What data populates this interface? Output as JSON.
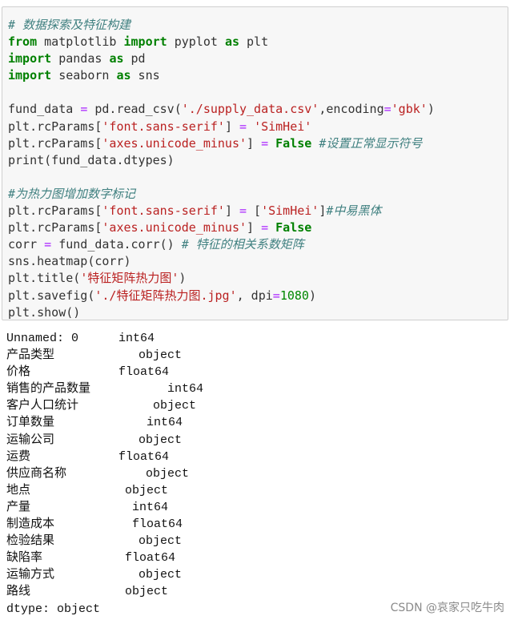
{
  "code_cell": {
    "lines": [
      [
        [
          "cm",
          "# 数据探索及特征构建"
        ]
      ],
      [
        [
          "kw",
          "from"
        ],
        [
          "t",
          " matplotlib "
        ],
        [
          "kw",
          "import"
        ],
        [
          "t",
          " pyplot "
        ],
        [
          "kw",
          "as"
        ],
        [
          "t",
          " plt"
        ]
      ],
      [
        [
          "kw",
          "import"
        ],
        [
          "t",
          " pandas "
        ],
        [
          "kw",
          "as"
        ],
        [
          "t",
          " pd"
        ]
      ],
      [
        [
          "kw",
          "import"
        ],
        [
          "t",
          " seaborn "
        ],
        [
          "kw",
          "as"
        ],
        [
          "t",
          " sns"
        ]
      ],
      [],
      [
        [
          "t",
          "fund_data "
        ],
        [
          "op",
          "="
        ],
        [
          "t",
          " pd.read_csv("
        ],
        [
          "str",
          "'./supply_data.csv'"
        ],
        [
          "t",
          ",encoding"
        ],
        [
          "op",
          "="
        ],
        [
          "str",
          "'gbk'"
        ],
        [
          "t",
          ")"
        ]
      ],
      [
        [
          "t",
          "plt.rcParams["
        ],
        [
          "str",
          "'font.sans-serif'"
        ],
        [
          "t",
          "] "
        ],
        [
          "op",
          "="
        ],
        [
          "t",
          " "
        ],
        [
          "str",
          "'SimHei'"
        ]
      ],
      [
        [
          "t",
          "plt.rcParams["
        ],
        [
          "str",
          "'axes.unicode_minus'"
        ],
        [
          "t",
          "] "
        ],
        [
          "op",
          "="
        ],
        [
          "t",
          " "
        ],
        [
          "kw",
          "False"
        ],
        [
          "t",
          " "
        ],
        [
          "cm",
          "#设置正常显示符号"
        ]
      ],
      [
        [
          "t",
          "print(fund_data.dtypes)"
        ]
      ],
      [],
      [
        [
          "cm",
          "#为热力图增加数字标记"
        ]
      ],
      [
        [
          "t",
          "plt.rcParams["
        ],
        [
          "str",
          "'font.sans-serif'"
        ],
        [
          "t",
          "] "
        ],
        [
          "op",
          "="
        ],
        [
          "t",
          " ["
        ],
        [
          "str",
          "'SimHei'"
        ],
        [
          "t",
          "]"
        ],
        [
          "cm",
          "#中易黑体"
        ]
      ],
      [
        [
          "t",
          "plt.rcParams["
        ],
        [
          "str",
          "'axes.unicode_minus'"
        ],
        [
          "t",
          "] "
        ],
        [
          "op",
          "="
        ],
        [
          "t",
          " "
        ],
        [
          "kw",
          "False"
        ]
      ],
      [
        [
          "t",
          "corr "
        ],
        [
          "op",
          "="
        ],
        [
          "t",
          " fund_data.corr() "
        ],
        [
          "cm",
          "# 特征的相关系数矩阵"
        ]
      ],
      [
        [
          "t",
          "sns.heatmap(corr)"
        ]
      ],
      [
        [
          "t",
          "plt.title("
        ],
        [
          "str",
          "'特征矩阵热力图'"
        ],
        [
          "t",
          ")"
        ]
      ],
      [
        [
          "t",
          "plt.savefig("
        ],
        [
          "str",
          "'./特征矩阵热力图.jpg'"
        ],
        [
          "t",
          ", dpi"
        ],
        [
          "op",
          "="
        ],
        [
          "num",
          "1080"
        ],
        [
          "t",
          ")"
        ]
      ],
      [
        [
          "t",
          "plt.show()"
        ]
      ]
    ]
  },
  "output": {
    "rows": [
      {
        "name": "Unnamed: 0",
        "dtype": "int64"
      },
      {
        "name": "产品类型",
        "dtype": "object"
      },
      {
        "name": "价格",
        "dtype": "float64"
      },
      {
        "name": "销售的产品数量",
        "dtype": "int64"
      },
      {
        "name": "客户人口统计",
        "dtype": "object"
      },
      {
        "name": "订单数量",
        "dtype": "int64"
      },
      {
        "name": "运输公司",
        "dtype": "object"
      },
      {
        "name": "运费",
        "dtype": "float64"
      },
      {
        "name": "供应商名称",
        "dtype": "object"
      },
      {
        "name": "地点",
        "dtype": "object"
      },
      {
        "name": "产量",
        "dtype": "int64"
      },
      {
        "name": "制造成本",
        "dtype": "float64"
      },
      {
        "name": "检验结果",
        "dtype": "object"
      },
      {
        "name": "缺陷率",
        "dtype": "float64"
      },
      {
        "name": "运输方式",
        "dtype": "object"
      },
      {
        "name": "路线",
        "dtype": "object"
      }
    ],
    "footer": "dtype: object"
  },
  "watermark": "CSDN @哀家只吃牛肉",
  "colors": {
    "keyword": "#008000",
    "string": "#ba2121",
    "comment": "#408080",
    "operator": "#aa22ff",
    "number": "#008800",
    "cell_bg": "#f7f7f7"
  }
}
